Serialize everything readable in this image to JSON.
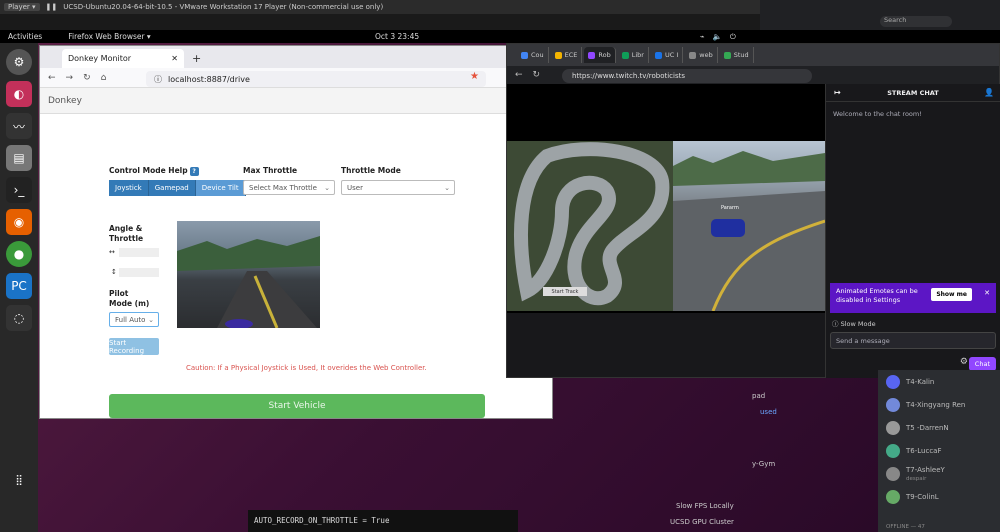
{
  "vm": {
    "player_label": "Player ▾",
    "title": "UCSD-Ubuntu20.04-64-bit-10.5 - VMware Workstation 17 Player (Non-commercial use only)"
  },
  "gnome": {
    "activities": "Activities",
    "app": "Firefox Web Browser ▾",
    "clock": "Oct 3  23:45"
  },
  "firefox": {
    "tab_title": "Donkey Monitor",
    "url": "localhost:8887/drive",
    "header": "Donkey",
    "control_mode_label": "Control Mode Help",
    "control_modes": [
      "Joystick",
      "Gamepad",
      "Device Tilt"
    ],
    "max_throttle_label": "Max Throttle",
    "max_throttle_value": "Select Max Throttle",
    "throttle_mode_label": "Throttle Mode",
    "throttle_mode_value": "User",
    "angle_label": "Angle & Throttle",
    "pilot_label": "Pilot Mode (m)",
    "pilot_value": "Full Auto",
    "start_recording": "Start Recording",
    "caution": "Caution: If a Physical Joystick is Used, It overides the Web Controller.",
    "start_vehicle": "Start Vehicle"
  },
  "twitch": {
    "tabs": [
      "Cou",
      "ECE",
      "Rob",
      "Libr",
      "UC I",
      "web",
      "Stud"
    ],
    "url": "https://www.twitch.tv/roboticists",
    "track_button": "Start Track",
    "sim_car_label": "Pararm",
    "chat_header": "STREAM CHAT",
    "welcome": "Welcome to the chat room!",
    "promo_text": "Animated Emotes can be disabled in Settings",
    "show_me": "Show me",
    "slow_mode": "Slow Mode",
    "send_placeholder": "Send a message",
    "chat_button": "Chat"
  },
  "discord_users": [
    {
      "name": "T4-Kalin",
      "sub": ""
    },
    {
      "name": "T4-Xingyang Ren",
      "sub": ""
    },
    {
      "name": "T5 -DarrenN",
      "sub": ""
    },
    {
      "name": "T6-LuccaF",
      "sub": ""
    },
    {
      "name": "T7-AshleeY",
      "sub": "despair"
    },
    {
      "name": "T9-ColinL",
      "sub": ""
    }
  ],
  "discord_offline": "OFFLINE — 47",
  "side_text": {
    "pad": "pad",
    "used": "used",
    "gym": "y-Gym",
    "slow_fps": "Slow FPS Locally",
    "gpu": "UCSD GPU Cluster"
  },
  "terminal_line": "AUTO_RECORD_ON_THROTTLE = True",
  "search_placeholder": "Search"
}
